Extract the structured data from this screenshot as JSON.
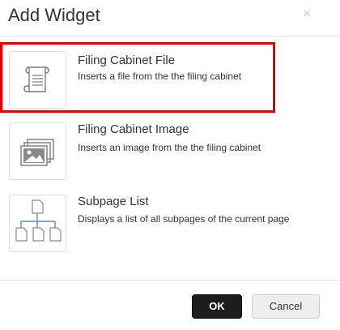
{
  "dialog": {
    "title": "Add Widget",
    "close_glyph": "×"
  },
  "widgets": [
    {
      "name": "Filing Cabinet File",
      "description": "Inserts a file from the the filing cabinet",
      "icon": "scroll-document-icon",
      "selected": true
    },
    {
      "name": "Filing Cabinet Image",
      "description": "Inserts an image from the the filing cabinet",
      "icon": "image-stack-icon",
      "selected": false
    },
    {
      "name": "Subpage List",
      "description": "Displays a list of all subpages of the current page",
      "icon": "page-hierarchy-icon",
      "selected": false
    }
  ],
  "footer": {
    "ok_label": "OK",
    "cancel_label": "Cancel"
  },
  "colors": {
    "selection_border": "#e00000",
    "ok_background": "#1d1d1d",
    "icon_gray": "#8a8a8a",
    "icon_blue": "#5a8ac6"
  }
}
